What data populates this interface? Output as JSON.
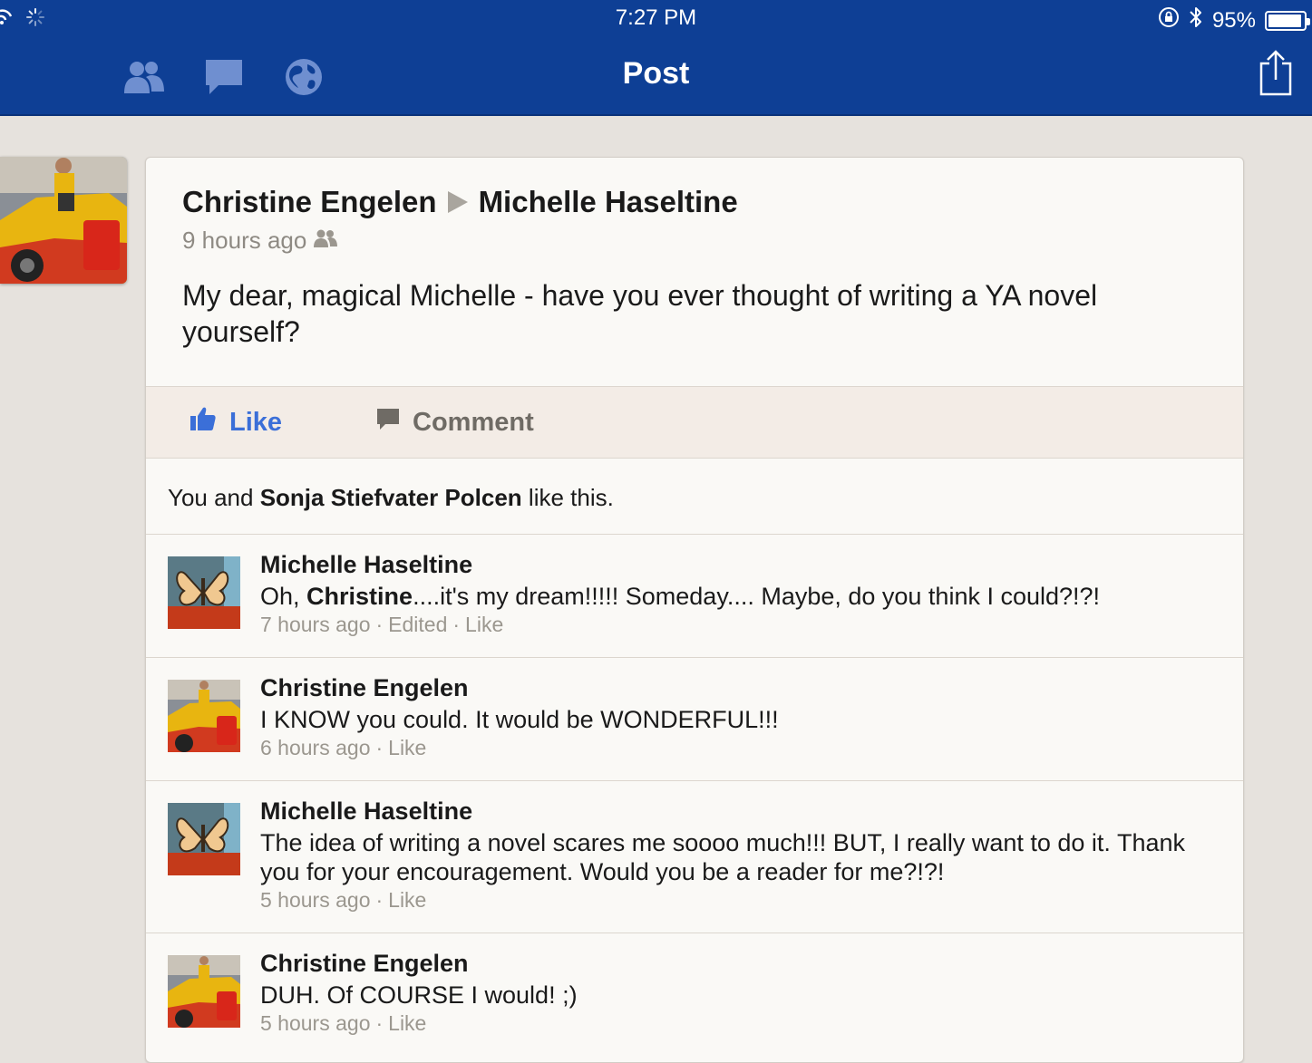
{
  "status_bar": {
    "time": "7:27 PM",
    "battery_text": "95%",
    "battery_level": 0.95,
    "icons": [
      "wifi-icon",
      "activity-spinner-icon",
      "orientation-lock-icon",
      "bluetooth-icon",
      "battery-icon"
    ]
  },
  "nav": {
    "title": "Post",
    "left_icons": [
      "friends-icon",
      "messages-icon",
      "notifications-globe-icon"
    ],
    "right_icon": "share-icon",
    "bar_color": "#0e3f95"
  },
  "post": {
    "author": "Christine Engelen",
    "target": "Michelle Haseltine",
    "time": "9 hours ago",
    "audience_icon": "friends-audience-icon",
    "body": "My dear, magical Michelle - have you ever thought of writing a YA novel yourself?"
  },
  "actions": {
    "like_label": "Like",
    "comment_label": "Comment",
    "like_color": "#3b6fd8"
  },
  "likes": {
    "prefix": "You and ",
    "name": "Sonja Stiefvater Polcen",
    "suffix": " like this."
  },
  "comments": [
    {
      "author": "Michelle Haseltine",
      "text_prefix": "Oh, ",
      "text_bold": "Christine",
      "text_rest": "....it's my dream!!!!! Someday.... Maybe, do you think I could?!?!",
      "time": "7 hours ago",
      "edited": "Edited",
      "like": "Like"
    },
    {
      "author": "Christine Engelen",
      "text": "I KNOW you could. It would be WONDERFUL!!!",
      "time": "6 hours ago",
      "like": "Like"
    },
    {
      "author": "Michelle Haseltine",
      "text": "The idea of writing a novel scares me soooo much!!! BUT, I really want to do it. Thank you for your encouragement. Would you be a reader for me?!?!",
      "time": "5 hours ago",
      "like": "Like"
    },
    {
      "author": "Christine Engelen",
      "text": "DUH. Of COURSE I would! ;)",
      "time": "5 hours ago",
      "like": "Like"
    }
  ],
  "separator": "·"
}
